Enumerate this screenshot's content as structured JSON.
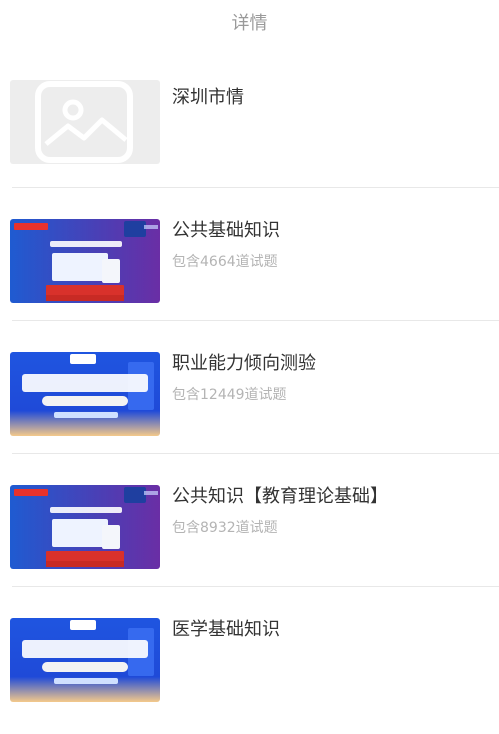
{
  "header": {
    "title": "详情"
  },
  "items": [
    {
      "title": "深圳市情",
      "subtitle": ""
    },
    {
      "title": "公共基础知识",
      "subtitle": "包含4664道试题"
    },
    {
      "title": "职业能力倾向测验",
      "subtitle": "包含12449道试题"
    },
    {
      "title": "公共知识【教育理论基础】",
      "subtitle": "包含8932道试题"
    },
    {
      "title": "医学基础知识",
      "subtitle": ""
    }
  ]
}
